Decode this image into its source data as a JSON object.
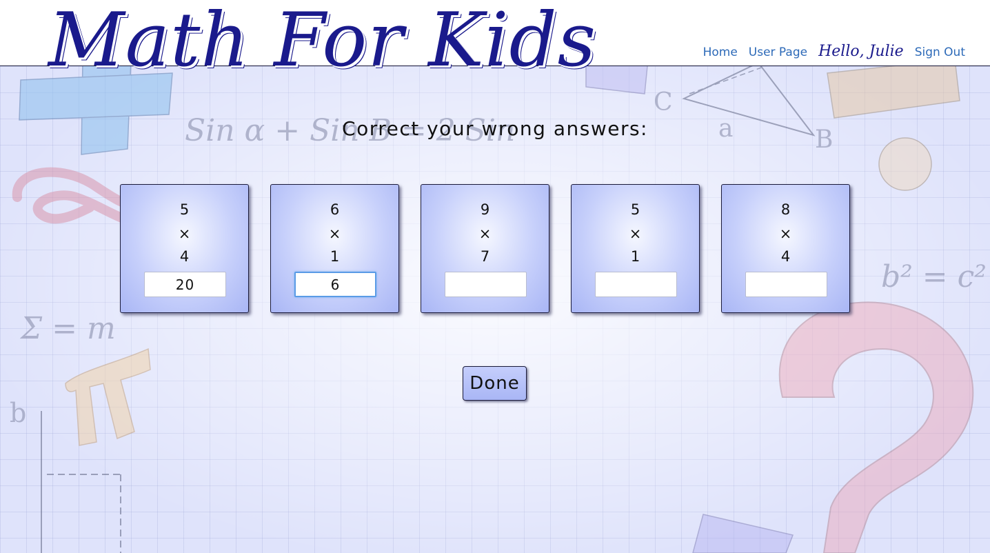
{
  "header": {
    "logo_text": "Math For Kids",
    "nav": {
      "home": "Home",
      "user_page": "User Page",
      "greeting": "Hello, Julie",
      "sign_out": "Sign Out"
    }
  },
  "main": {
    "prompt": "Correct your wrong answers:",
    "problems": [
      {
        "a": "5",
        "op": "×",
        "b": "4",
        "answer": "20"
      },
      {
        "a": "6",
        "op": "×",
        "b": "1",
        "answer": "6"
      },
      {
        "a": "9",
        "op": "×",
        "b": "7",
        "answer": ""
      },
      {
        "a": "5",
        "op": "×",
        "b": "1",
        "answer": ""
      },
      {
        "a": "8",
        "op": "×",
        "b": "4",
        "answer": ""
      }
    ],
    "done_label": "Done"
  },
  "background_doodles": {
    "formula_1": "Sin α + Sin B = 2 Sin",
    "formula_2": "b² = c²",
    "sigma": "Σ = m",
    "triangle_c": "C",
    "triangle_a": "a",
    "triangle_b": "B",
    "axis_b": "b"
  },
  "colors": {
    "logo": "#1a1a8c",
    "nav_link": "#2d6ab8",
    "card_center": "#f5f7ff",
    "card_edge": "#a9b6f5",
    "background": "#dfe3fb",
    "focus_ring": "#5a9be6"
  }
}
